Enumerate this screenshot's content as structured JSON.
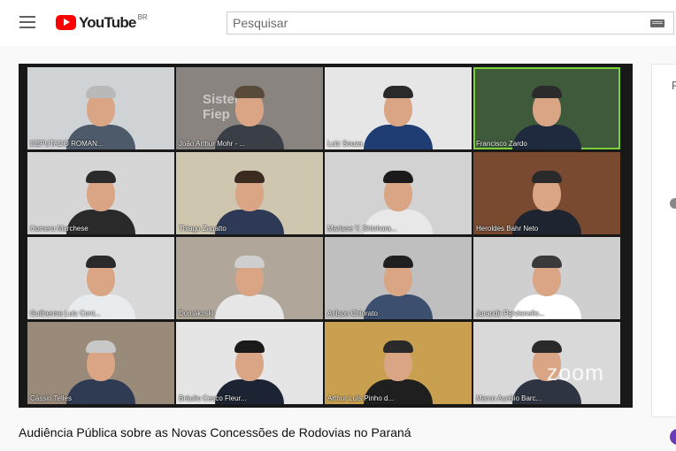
{
  "header": {
    "logo_text": "YouTube",
    "logo_country": "BR",
    "search_placeholder": "Pesquisar"
  },
  "video": {
    "title": "Audiência Pública sobre as Novas Concessões de Rodovias no Paraná",
    "watermark": "zoom",
    "participants": [
      {
        "name": "DEPUTADO ROMAN...",
        "bg": "#cfd3d6",
        "shirt": "#4d5a6a",
        "hair": "#b9b9b9"
      },
      {
        "name": "João Arthur Mohr - ...",
        "bg": "#8a8480",
        "shirt": "#3a3f47",
        "hair": "#5a4a3a",
        "bg_text": "Sistema Fiep"
      },
      {
        "name": "Luiz Souza",
        "bg": "#e6e6e6",
        "shirt": "#1f3c73",
        "hair": "#2a2a2a"
      },
      {
        "name": "Francisco Zardo",
        "bg": "#3e5a3a",
        "shirt": "#1f2a3f",
        "hair": "#2b2b2b"
      },
      {
        "name": "Homero Marchese",
        "bg": "#d6d6d6",
        "shirt": "#2a2a2a",
        "hair": "#2b2b2b"
      },
      {
        "name": "Thiago Zagatto",
        "bg": "#cfc6b0",
        "shirt": "#2e3a55",
        "hair": "#3a2a20"
      },
      {
        "name": "Mariane Y. Shiohara...",
        "bg": "#d2d2d2",
        "shirt": "#e8e8e8",
        "hair": "#1a1a1a"
      },
      {
        "name": "Heroldes Bahr Neto",
        "bg": "#7a4a30",
        "shirt": "#1f2530",
        "hair": "#2a2a2a"
      },
      {
        "name": "Guilherme Luiz Cont...",
        "bg": "#d8d8d8",
        "shirt": "#e9ecef",
        "hair": "#2a2a2a"
      },
      {
        "name": "Domakoski",
        "bg": "#b0a79a",
        "shirt": "#e6e6e6",
        "hair": "#cfcfcf"
      },
      {
        "name": "Arilson Chiorato",
        "bg": "#bfbfbf",
        "shirt": "#3d4f6e",
        "hair": "#1f1f1f"
      },
      {
        "name": "Jurandir Parzianello...",
        "bg": "#cfcfcf",
        "shirt": "#ffffff",
        "hair": "#3a3a3a"
      },
      {
        "name": "Cássio Telles",
        "bg": "#9a8a7a",
        "shirt": "#2f3b52",
        "hair": "#c8c8c8"
      },
      {
        "name": "Bráulio Cesco Fleur...",
        "bg": "#e5e5e5",
        "shirt": "#1c2433",
        "hair": "#1a1a1a"
      },
      {
        "name": "Arthur Luís Pinho d...",
        "bg": "#c8a050",
        "shirt": "#1f1f1f",
        "hair": "#2a2a2a"
      },
      {
        "name": "Marco Aurélio Barc...",
        "bg": "#d9d9d9",
        "shirt": "#2e3442",
        "hair": "#2a2a2a"
      }
    ]
  },
  "sidebar": {
    "partial_letter": "P"
  },
  "colors": {
    "active_speaker_border": "#7bd03b",
    "brand_red": "#ff0000"
  }
}
